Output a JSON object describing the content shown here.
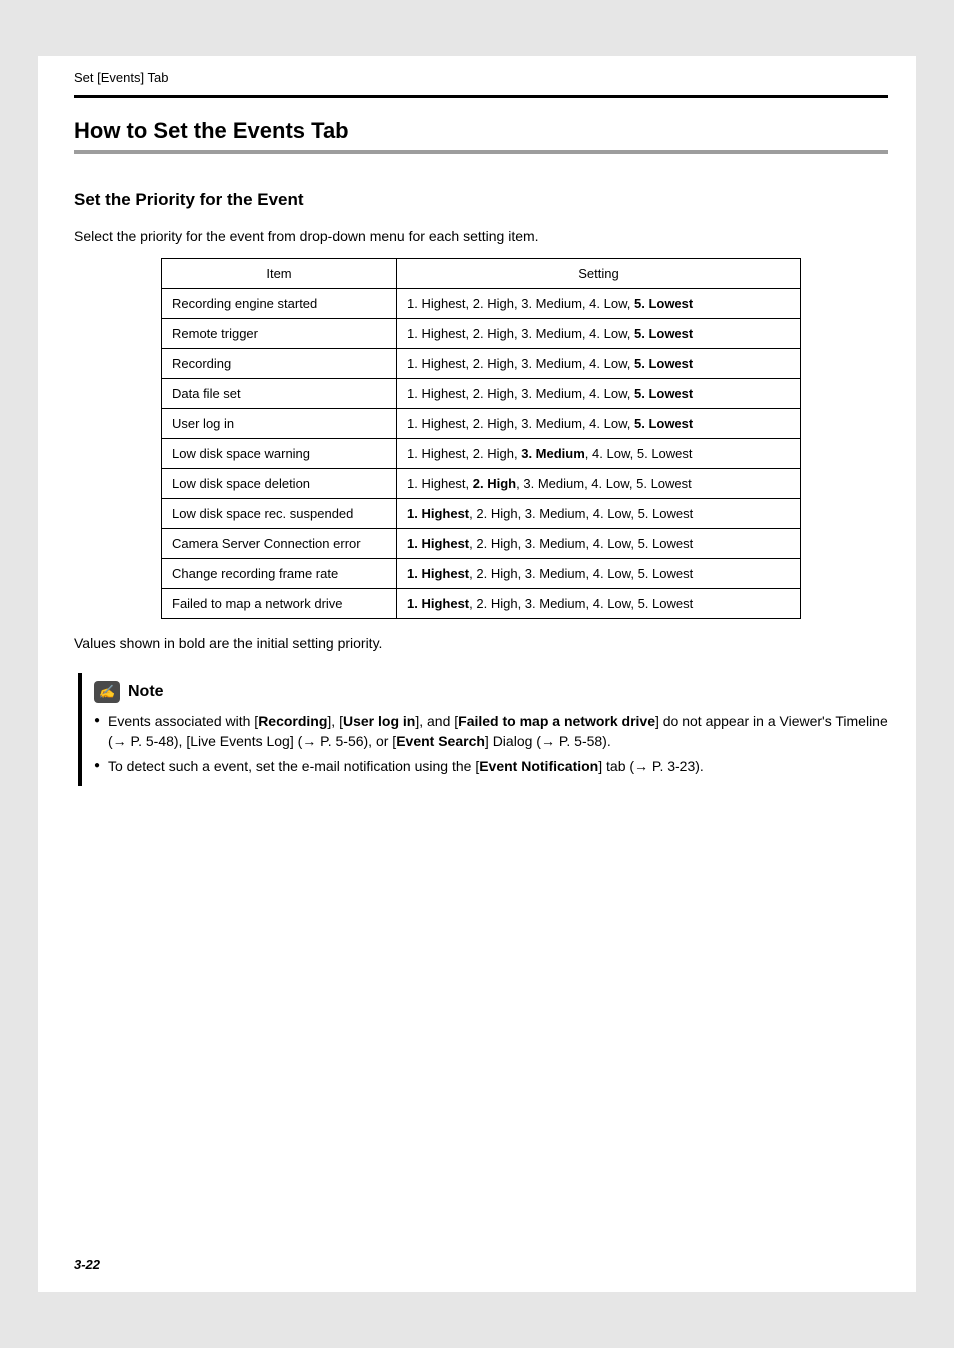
{
  "header": {
    "tab_label": "Set [Events] Tab"
  },
  "title": "How to Set the Events Tab",
  "section": {
    "heading": "Set the Priority for the Event",
    "intro": "Select the priority for the event from drop-down menu for each setting item."
  },
  "table": {
    "headers": {
      "item": "Item",
      "setting": "Setting"
    },
    "option_text": {
      "p1": "1. Highest",
      "p2": "2. High",
      "p3": "3. Medium",
      "p4": "4. Low",
      "p5": "5. Lowest"
    },
    "rows": [
      {
        "item": "Recording engine started",
        "default": 5
      },
      {
        "item": "Remote trigger",
        "default": 5
      },
      {
        "item": "Recording",
        "default": 5
      },
      {
        "item": "Data file set",
        "default": 5
      },
      {
        "item": "User log in",
        "default": 5
      },
      {
        "item": "Low disk space warning",
        "default": 3
      },
      {
        "item": "Low disk space deletion",
        "default": 2
      },
      {
        "item": "Low disk space rec. suspended",
        "default": 1
      },
      {
        "item": "Camera Server Connection error",
        "default": 1
      },
      {
        "item": "Change recording frame rate",
        "default": 1
      },
      {
        "item": "Failed to map a network drive",
        "default": 1
      }
    ]
  },
  "caption": "Values shown in bold are the initial setting priority.",
  "note": {
    "label": "Note",
    "items": [
      {
        "pre": "Events associated with [",
        "b1": "Recording",
        "mid1": "], [",
        "b2": "User log in",
        "mid2": "], and [",
        "b3": "Failed to map a network drive",
        "post1": "] do not appear in a Viewer's Timeline (",
        "arrow1": "→",
        "ref1": " P. 5-48), [Live Events Log] (",
        "arrow2": "→",
        "ref2": " P. 5-56), or [",
        "b4": "Event Search",
        "post2": "] Dialog (",
        "arrow3": "→",
        "ref3": " P. 5-58)."
      },
      {
        "pre": "To detect such a event, set the e-mail notification using the [",
        "b1": "Event Notification",
        "post": "] tab (",
        "arrow": "→",
        "ref": " P. 3-23)."
      }
    ]
  },
  "page_number": "3-22"
}
